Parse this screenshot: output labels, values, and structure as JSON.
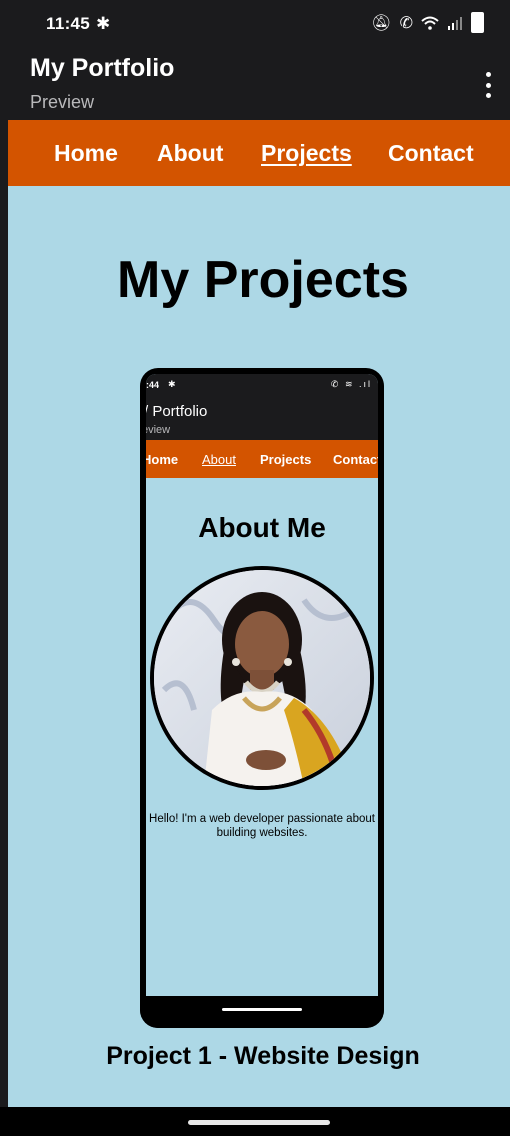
{
  "status_bar": {
    "time": "11:45",
    "icons": [
      "gear-icon",
      "notifications-off-icon",
      "wifi-calling-icon",
      "wifi-icon",
      "signal-icon",
      "battery-icon"
    ]
  },
  "app_bar": {
    "title": "My Portfolio",
    "subtitle": "Preview",
    "menu_icon": "more-vertical-icon"
  },
  "nav": {
    "items": [
      {
        "label": "Home"
      },
      {
        "label": "About"
      },
      {
        "label": "Projects",
        "active": true
      },
      {
        "label": "Contact"
      }
    ]
  },
  "main": {
    "heading": "My Projects",
    "project_caption": "Project 1 - Website Design"
  },
  "preview": {
    "status_time": ":44",
    "app_title": "/ Portfolio",
    "app_subtitle": "eview",
    "nav": [
      "Home",
      "About",
      "Projects",
      "Contact"
    ],
    "heading": "About Me",
    "bio": "Hello! I'm a web developer passionate about building websites."
  },
  "colors": {
    "page_bg": "#add8e6",
    "nav_bg": "#d35400",
    "chrome_bg": "#1b1b1d"
  }
}
